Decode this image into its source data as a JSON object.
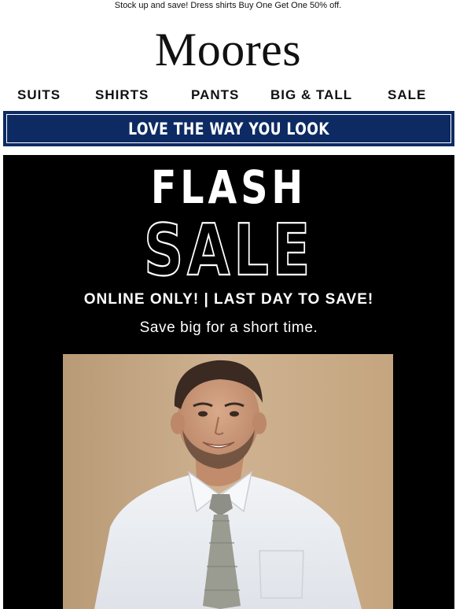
{
  "preheader": "Stock up and save! Dress shirts Buy One Get One 50% off.",
  "brand": {
    "logo_text": "Moores"
  },
  "nav": {
    "items": [
      {
        "label": "SUITS"
      },
      {
        "label": "SHIRTS"
      },
      {
        "label": "PANTS"
      },
      {
        "label": "BIG & TALL"
      },
      {
        "label": "SALE"
      }
    ]
  },
  "banner": {
    "text": "LOVE THE WAY YOU LOOK",
    "color": "#0d2a63"
  },
  "hero": {
    "headline_top": "FLASH",
    "headline_bottom": "SALE",
    "subline": "ONLINE ONLY!  |  LAST DAY TO SAVE!",
    "tagline": "Save big for a short time.",
    "background": "#000000",
    "image": {
      "icon": "model-photo"
    }
  }
}
